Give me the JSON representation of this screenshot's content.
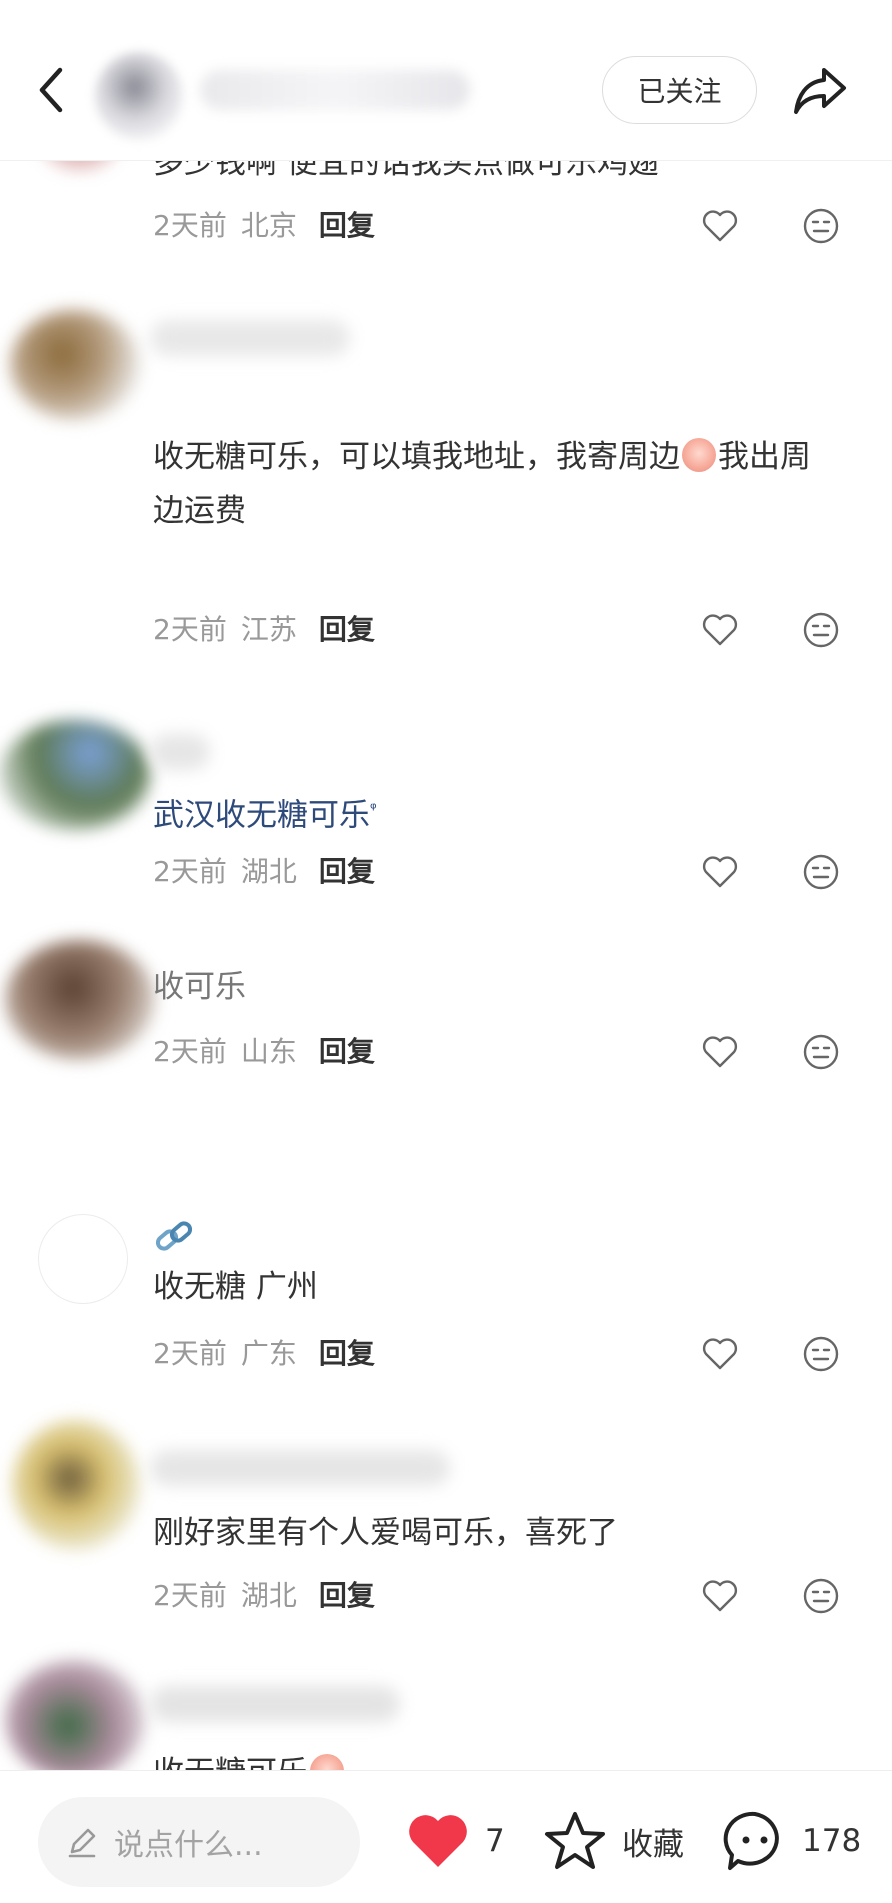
{
  "header": {
    "author_name": "",
    "follow_label": "已关注"
  },
  "comments": [
    {
      "text": "多少钱啊 便宜的话我买点做可乐鸡翅",
      "time": "2天前",
      "location": "北京",
      "reply_label": "回复"
    },
    {
      "text_a": "收无糖可乐，可以填我地址，我寄周边",
      "text_b": "我出周边运费",
      "emoji": "crying-face-emoji",
      "time": "2天前",
      "location": "江苏",
      "reply_label": "回复"
    },
    {
      "text": "武汉收无糖可乐",
      "search_mark": "ᵠ",
      "time": "2天前",
      "location": "湖北",
      "reply_label": "回复"
    },
    {
      "text": "收可乐",
      "time": "2天前",
      "location": "山东",
      "reply_label": "回复"
    },
    {
      "name_icon": "link-emoji",
      "text": "收无糖 广州",
      "time": "2天前",
      "location": "广东",
      "reply_label": "回复"
    },
    {
      "text": "刚好家里有个人爱喝可乐，喜死了",
      "time": "2天前",
      "location": "湖北",
      "reply_label": "回复"
    },
    {
      "text": "收无糖可乐",
      "emoji": "baby-face-emoji"
    }
  ],
  "bottom_bar": {
    "input_placeholder": "说点什么...",
    "like_count": "7",
    "collect_label": "收藏",
    "comment_count": "178"
  },
  "colors": {
    "like_red": "#f0384a",
    "link_blue": "#2e4a7a",
    "meta_gray": "#999999"
  }
}
